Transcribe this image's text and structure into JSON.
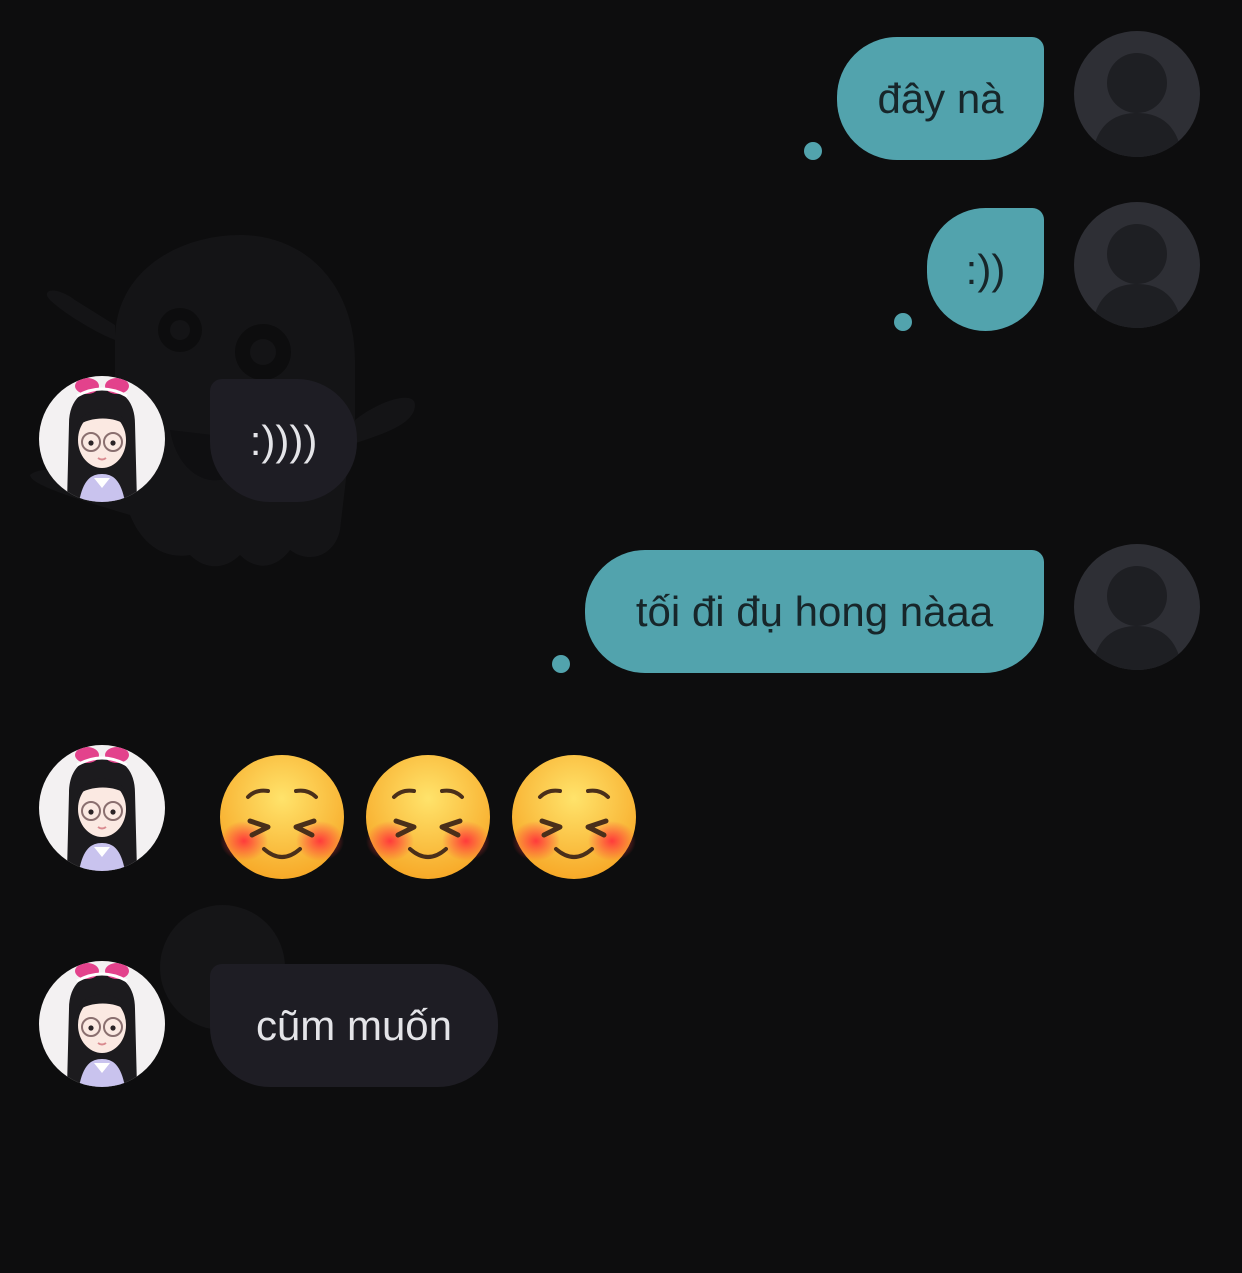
{
  "theme": {
    "background": "#0d0d0e",
    "outgoing_bubble": "#52a3ad",
    "incoming_bubble": "#1e1d24"
  },
  "messages": [
    {
      "direction": "outgoing",
      "text": "đây nà"
    },
    {
      "direction": "outgoing",
      "text": ":))"
    },
    {
      "direction": "incoming",
      "text": ":))))"
    },
    {
      "direction": "outgoing",
      "text": "tối đi đụ hong nàaa"
    },
    {
      "direction": "incoming",
      "emojis": [
        "smiling-face-with-closed-eyes-blush-emoji",
        "smiling-face-with-closed-eyes-blush-emoji",
        "smiling-face-with-closed-eyes-blush-emoji"
      ]
    },
    {
      "direction": "incoming",
      "text": "cũm muốn"
    }
  ],
  "icons": {
    "outgoing_avatar": "default-user-silhouette-icon",
    "incoming_avatar": "cartoon-girl-avatar",
    "watermark": "ghost-icon"
  }
}
